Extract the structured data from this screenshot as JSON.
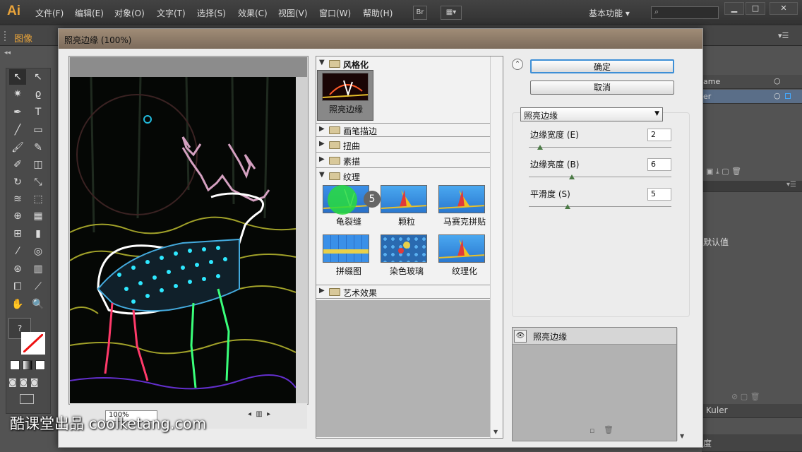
{
  "app": {
    "logo": "Ai"
  },
  "menubar": {
    "items": [
      "文件(F)",
      "编辑(E)",
      "对象(O)",
      "文字(T)",
      "选择(S)",
      "效果(C)",
      "视图(V)",
      "窗口(W)",
      "帮助(H)"
    ],
    "bridge_label": "Br",
    "workspace_label": "基本功能",
    "search_placeholder": "",
    "window_controls": [
      "minimize-icon",
      "maximize-icon",
      "close-icon"
    ]
  },
  "control_bar": {
    "label": "图像"
  },
  "right_panel": {
    "rows": [
      "ame",
      "er",
      "默认值",
      "Kuler",
      "度"
    ]
  },
  "dialog": {
    "title": "照亮边缘 (100%)",
    "ok_label": "确定",
    "cancel_label": "取消",
    "categories": [
      {
        "name": "风格化",
        "expanded": true,
        "filters": [
          "照亮边缘"
        ]
      },
      {
        "name": "画笔描边",
        "expanded": false
      },
      {
        "name": "扭曲",
        "expanded": false
      },
      {
        "name": "素描",
        "expanded": false
      },
      {
        "name": "纹理",
        "expanded": true,
        "filters": [
          "龟裂缝",
          "颗粒",
          "马赛克拼贴",
          "拼缀图",
          "染色玻璃",
          "纹理化"
        ]
      },
      {
        "name": "艺术效果",
        "expanded": false
      }
    ],
    "selected_filter": "照亮边缘",
    "cursor_badge": "5",
    "params": [
      {
        "label": "边缘宽度 (E)",
        "value": "2",
        "fraction": 0.08
      },
      {
        "label": "边缘亮度 (B)",
        "value": "6",
        "fraction": 0.3
      },
      {
        "label": "平滑度 (S)",
        "value": "5",
        "fraction": 0.27
      }
    ],
    "layer": {
      "name": "照亮边缘"
    },
    "zoom": "100%"
  },
  "watermark": "酷课堂出品 coolketang.com",
  "colors": {
    "accent": "#3d8fd6",
    "ai_orange": "#e8a33a",
    "knob": "#4b7a45"
  }
}
